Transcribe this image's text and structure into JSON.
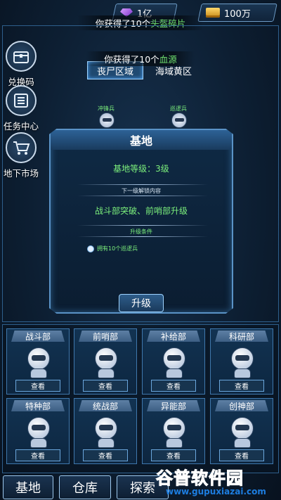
{
  "topbar": {
    "gems": "1亿",
    "gold": "100万"
  },
  "toasts": {
    "first_prefix": "你获得了10个",
    "first_item": "头盔碎片",
    "second_prefix": "你获得了10个",
    "second_item": "血源"
  },
  "sidebar": {
    "items": [
      {
        "label": "兑换码",
        "icon": "chest-icon"
      },
      {
        "label": "任务中心",
        "icon": "list-icon"
      },
      {
        "label": "地下市场",
        "icon": "cart-icon"
      }
    ]
  },
  "zones": {
    "active": "丧尸区域",
    "other": "海域黄区"
  },
  "soldiers": [
    {
      "label": "冲锋兵"
    },
    {
      "label": "巡逻兵"
    }
  ],
  "base_panel": {
    "title": "基地",
    "level": "基地等级：3级",
    "unlock_header": "下一级解锁内容",
    "unlock_content": "战斗部突破、前哨部升级",
    "condition_header": "升级条件",
    "condition": "拥有10个巡逻兵",
    "upgrade_label": "升级"
  },
  "departments": [
    {
      "name": "战斗部",
      "view": "查看"
    },
    {
      "name": "前哨部",
      "view": "查看"
    },
    {
      "name": "补给部",
      "view": "查看"
    },
    {
      "name": "科研部",
      "view": "查看"
    },
    {
      "name": "特种部",
      "view": "查看"
    },
    {
      "name": "统战部",
      "view": "查看"
    },
    {
      "name": "异能部",
      "view": "查看"
    },
    {
      "name": "创神部",
      "view": "查看"
    }
  ],
  "bottom_nav": [
    {
      "label": "基地"
    },
    {
      "label": "仓库"
    },
    {
      "label": "探索"
    }
  ],
  "watermark": {
    "main": "谷普软件园",
    "sub": "www.gupuxiazai.com"
  },
  "colors": {
    "highlight_green": "#6fe06f",
    "accent_blue": "#4fa8ff",
    "watermark_orange": "#ff7a1a"
  }
}
